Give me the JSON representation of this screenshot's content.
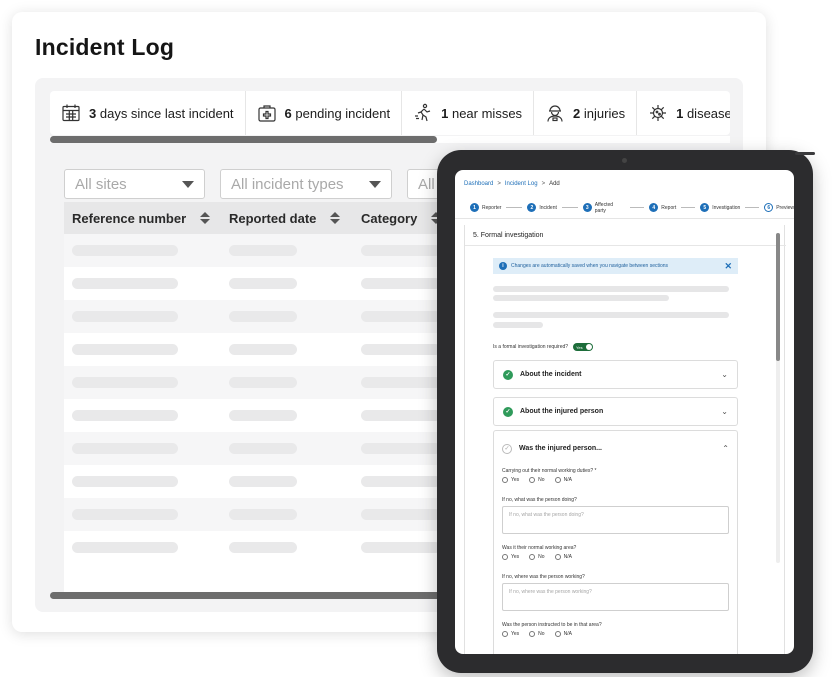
{
  "page": {
    "title": "Incident Log"
  },
  "stats": [
    {
      "icon": "calendar-icon",
      "value": "3",
      "label": "days since last incident"
    },
    {
      "icon": "first-aid-kit-icon",
      "value": "6",
      "label": "pending incident"
    },
    {
      "icon": "running-person-icon",
      "value": "1",
      "label": "near misses"
    },
    {
      "icon": "worker-icon",
      "value": "2",
      "label": "injuries"
    },
    {
      "icon": "virus-icon",
      "value": "1",
      "label": "diseases"
    }
  ],
  "filters": {
    "sites": "All sites",
    "incident_types": "All incident types",
    "third": "All"
  },
  "table": {
    "columns": [
      "Reference number",
      "Reported date",
      "Category"
    ]
  },
  "tablet": {
    "breadcrumbs": [
      "Dashboard",
      "Incident Log",
      "Add"
    ],
    "steps": [
      {
        "num": "1",
        "label": "Reporter"
      },
      {
        "num": "2",
        "label": "Incident"
      },
      {
        "num": "3",
        "label": "Affected party"
      },
      {
        "num": "4",
        "label": "Report"
      },
      {
        "num": "5",
        "label": "Investigation"
      },
      {
        "num": "6",
        "label": "Preview"
      }
    ],
    "section_title": "5. Formal investigation",
    "info_banner": "Changes are automatically saved when you navigate between sections",
    "toggle_question": "Is a formal investigation required?",
    "toggle_value": "Yes",
    "accordions": {
      "about_incident": "About the incident",
      "about_person": "About the injured person",
      "was_injured": "Was the injured person..."
    },
    "questions": {
      "q1": "Carrying out their normal working duties? *",
      "q1_follow": "If no, what was the person doing?",
      "q1_placeholder": "If no, what was the person doing?",
      "q2": "Was it their normal working area?",
      "q2_follow": "If no, where was the person working?",
      "q2_placeholder": "If no, where was the person working?",
      "q3": "Was the person instructed to be in that area?"
    },
    "radio_options": {
      "yes": "Yes",
      "no": "No",
      "na": "N/A"
    }
  }
}
